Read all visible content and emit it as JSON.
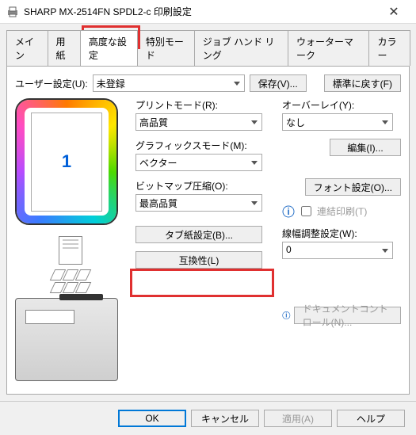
{
  "window": {
    "title": "SHARP MX-2514FN SPDL2-c 印刷設定"
  },
  "tabs": {
    "main": "メイン",
    "paper": "用紙",
    "advanced": "高度な設定",
    "special": "特別モード",
    "job": "ジョブ ハンド リング",
    "watermark": "ウォーターマーク",
    "color": "カラー"
  },
  "top": {
    "user_setting_label": "ユーザー設定(U):",
    "user_setting_value": "未登録",
    "save": "保存(V)...",
    "restore": "標準に戻す(F)"
  },
  "preview": {
    "page_number": "1"
  },
  "mid": {
    "print_mode_label": "プリントモード(R):",
    "print_mode_value": "高品質",
    "graphics_mode_label": "グラフィックスモード(M):",
    "graphics_mode_value": "ベクター",
    "bitmap_label": "ビットマップ圧縮(O):",
    "bitmap_value": "最高品質",
    "tab_paper_btn": "タブ紙設定(B)...",
    "compat_btn": "互換性(L)"
  },
  "right": {
    "overlay_label": "オーバーレイ(Y):",
    "overlay_value": "なし",
    "edit_btn": "編集(I)...",
    "font_btn": "フォント設定(O)...",
    "chain_print": "連結印刷(T)",
    "line_width_label": "線幅調整設定(W):",
    "line_width_value": "0",
    "doc_control": "ドキュメントコントロール(N)..."
  },
  "bottom": {
    "ok": "OK",
    "cancel": "キャンセル",
    "apply": "適用(A)",
    "help": "ヘルプ"
  }
}
